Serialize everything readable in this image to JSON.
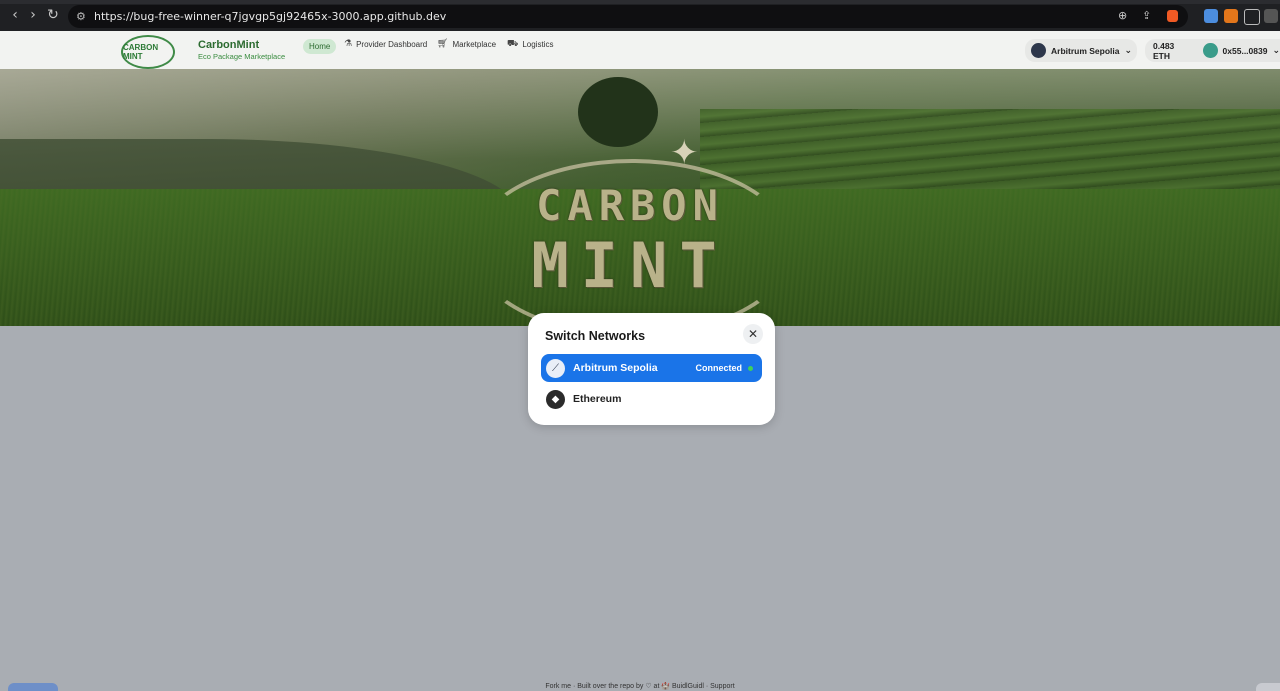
{
  "browser": {
    "url": "https://bug-free-winner-q7jgvgp5gj92465x-3000.app.github.dev"
  },
  "header": {
    "brand_name": "CarbonMint",
    "brand_tagline": "Eco Package Marketplace",
    "logo_text": "CARBON MINT",
    "nav": [
      {
        "label": "Home",
        "icon": "home"
      },
      {
        "label": "Provider Dashboard",
        "icon": "flask-icon"
      },
      {
        "label": "Marketplace",
        "icon": "cart-icon"
      },
      {
        "label": "Logistics",
        "icon": "truck-icon"
      }
    ],
    "network_selector": "Arbitrum Sepolia",
    "balance": "0.483 ETH",
    "address": "0x55...0839"
  },
  "hero": {
    "line1": "CARBON",
    "line2": "MINT"
  },
  "modal": {
    "title": "Switch Networks",
    "networks": [
      {
        "name": "Arbitrum Sepolia",
        "status": "Connected",
        "active": true
      },
      {
        "name": "Ethereum",
        "status": "",
        "active": false
      }
    ]
  },
  "footer": {
    "text": "Fork me · Built over the repo by ♡ at 🏰 BuidlGuidl · Support"
  },
  "colors": {
    "accent": "#1a74e8",
    "brand": "#2c6b30",
    "connected": "#3fd15a"
  }
}
